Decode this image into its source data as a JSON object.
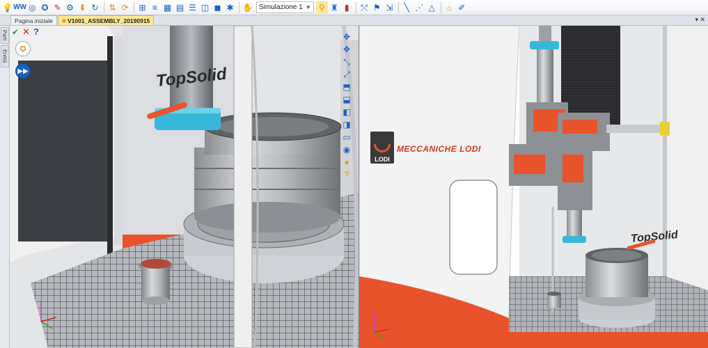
{
  "toolbar": {
    "simulation_select": "Simulazione 1",
    "icons": [
      "bulb-icon",
      "ww-icon",
      "spiral-icon",
      "compass-icon",
      "magic-wand-icon",
      "gear-icon",
      "arrow-down-icon",
      "refresh-icon",
      "transfer-icon",
      "refresh-yellow-icon",
      "axes-icon",
      "align-icon",
      "grid-icon",
      "palette-icon",
      "stack-icon",
      "layers-icon",
      "cube-icon",
      "star-icon",
      "hand-icon",
      "search-icon",
      "tower-icon",
      "tool-icon",
      "rotate-icon",
      "flag-icon",
      "ruler-icon",
      "measure-icon",
      "triangle-icon",
      "shape-icon",
      "brush-icon",
      "dropper-icon"
    ]
  },
  "tabs": {
    "home": "Pagina iniziale",
    "document": "V1001_ASSEMBLY_20190915",
    "window_controls": "▾ ✕"
  },
  "left_rail": {
    "tab_parts": "Parti",
    "tab_entities": "Entità"
  },
  "left_viewport": {
    "logo_text": "TopSolid",
    "ok_icon": "✔",
    "cancel_icon": "✕",
    "help_icon": "?"
  },
  "right_viewport": {
    "brand_text": "MECCANICHE LODI",
    "logo_mark_text": "LODI",
    "logo_text": "TopSolid"
  },
  "colors": {
    "accent_orange": "#e8532c",
    "cyan_ring": "#38b8d8",
    "machine_white": "#f2f2f2",
    "active_tab": "#fbe79a"
  }
}
